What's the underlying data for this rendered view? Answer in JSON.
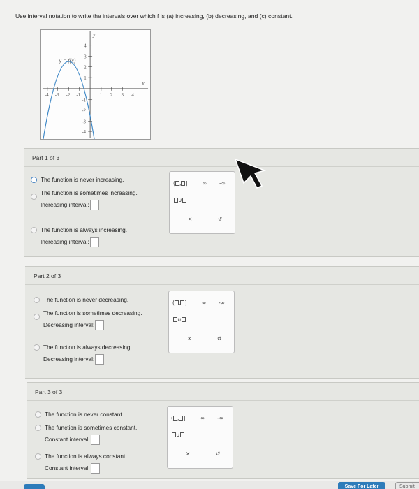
{
  "question": "Use interval notation to write the intervals over which f is (a) increasing, (b) decreasing, and (c) constant.",
  "graph": {
    "function_label": "y = f(x)",
    "x_axis_label": "x",
    "y_axis_label": "y",
    "x_ticks": [
      "-4",
      "-3",
      "-2",
      "-1",
      "1",
      "2",
      "3",
      "4"
    ],
    "y_ticks": [
      "4",
      "3",
      "2",
      "1",
      "-1",
      "-2",
      "-3",
      "-4"
    ]
  },
  "parts": [
    {
      "header": "Part 1 of 3",
      "options": [
        {
          "text": "The function is never increasing."
        },
        {
          "text": "The function is sometimes increasing.",
          "answer_label": "Increasing interval:"
        },
        {
          "text": "The function is always increasing.",
          "answer_label": "Increasing interval:"
        }
      ]
    },
    {
      "header": "Part 2 of 3",
      "options": [
        {
          "text": "The function is never decreasing."
        },
        {
          "text": "The function is sometimes decreasing.",
          "answer_label": "Decreasing interval:"
        },
        {
          "text": "The function is always decreasing.",
          "answer_label": "Decreasing interval:"
        }
      ]
    },
    {
      "header": "Part 3 of 3",
      "options": [
        {
          "text": "The function is never constant."
        },
        {
          "text": "The function is sometimes constant.",
          "answer_label": "Constant interval:"
        },
        {
          "text": "The function is always constant.",
          "answer_label": "Constant interval:"
        }
      ]
    }
  ],
  "palette": {
    "infinity": "∞",
    "neg_infinity": "-∞",
    "clear": "×",
    "undo": "↺"
  },
  "footer": {
    "save_label": "Save For Later",
    "submit_label": "Submit"
  },
  "colors": {
    "accent": "#2e7cba",
    "selected_radio": "#3a7bbf"
  }
}
